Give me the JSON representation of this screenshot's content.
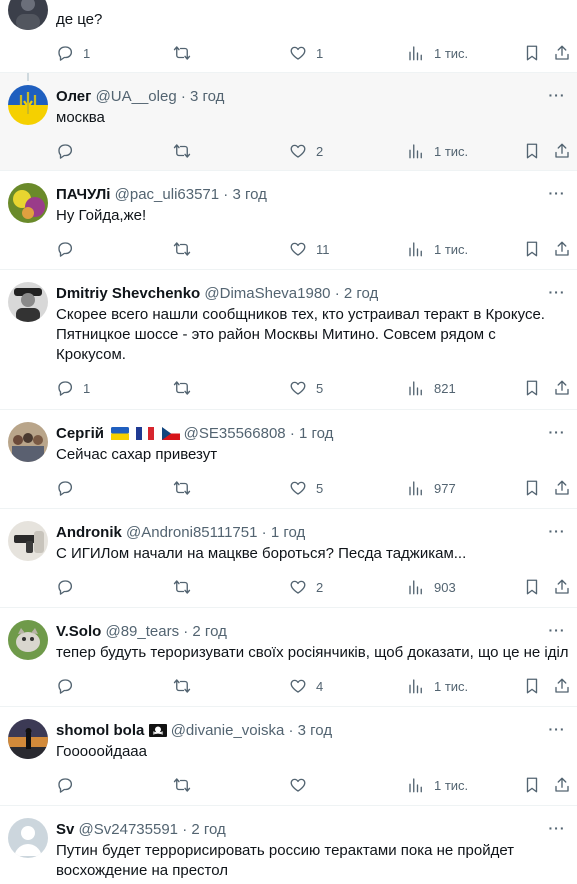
{
  "tweets": [
    {
      "name": "",
      "handle": "",
      "time": "",
      "text": "де це?",
      "replies": "1",
      "retweets": "",
      "likes": "1",
      "views": "1 тис.",
      "avatar": "partial-dark"
    },
    {
      "name": "Олег",
      "handle": "@UA__oleg",
      "time": "3 год",
      "text": "москва",
      "replies": "",
      "retweets": "",
      "likes": "2",
      "views": "1 тис.",
      "avatar": "ukraine-trident",
      "highlighted": true
    },
    {
      "name": "ПАЧУЛі",
      "handle": "@pac_uli63571",
      "time": "3 год",
      "text": "Ну Гойда,же!",
      "replies": "",
      "retweets": "",
      "likes": "11",
      "views": "1 тис.",
      "avatar": "green-yellow-photo"
    },
    {
      "name": "Dmitriy Shevchenko",
      "handle": "@DimaSheva1980",
      "time": "2 год",
      "text": "Скорее всего нашли сообщников тех, кто устраивал теракт в Крокусе.\nПятницкое шоссе - это район Москвы Митино. Совсем рядом с\nКрокусом.",
      "replies": "1",
      "retweets": "",
      "likes": "5",
      "views": "821",
      "avatar": "bw-officer-photo"
    },
    {
      "name": "Сергій",
      "handle": "@SE35566808",
      "time": "1 год",
      "flags": [
        "ua",
        "fr",
        "cz"
      ],
      "text": "Сейчас сахар привезут",
      "replies": "",
      "retweets": "",
      "likes": "5",
      "views": "977",
      "avatar": "group-photo"
    },
    {
      "name": "Andronik",
      "handle": "@Androni85111751",
      "time": "1 год",
      "text": "С ИГИЛом начали на мацкве бороться? Песда таджикам...",
      "replies": "",
      "retweets": "",
      "likes": "2",
      "views": "903",
      "avatar": "gun-photo"
    },
    {
      "name": "V.Solo",
      "handle": "@89_tears",
      "time": "2 год",
      "text": "тепер будуть тероризувати своїх росіянчиків, щоб доказати, що це не іділ",
      "replies": "",
      "retweets": "",
      "likes": "4",
      "views": "1 тис.",
      "avatar": "cat-on-grass"
    },
    {
      "name": "shomol bola",
      "handle": "@divanie_voiska",
      "time": "3 год",
      "badge": "skull-flag",
      "text": "Гооооойдааа",
      "replies": "",
      "retweets": "",
      "likes": "",
      "views": "1 тис.",
      "avatar": "sunset-silhouette"
    },
    {
      "name": "Sv",
      "handle": "@Sv24735591",
      "time": "2 год",
      "text": "Путин будет террорисировать россию терактами пока не пройдет\nвосхождение на престол",
      "replies": "",
      "retweets": "",
      "likes": "",
      "views": "",
      "avatar": "default-gray"
    }
  ],
  "colors": {
    "text": "#0f1419",
    "muted": "#536471",
    "divider": "#eff3f4",
    "highlight": "#f7f7f7"
  },
  "icons": [
    "reply-icon",
    "retweet-icon",
    "like-icon",
    "views-icon",
    "bookmark-icon",
    "share-icon",
    "more-icon"
  ]
}
